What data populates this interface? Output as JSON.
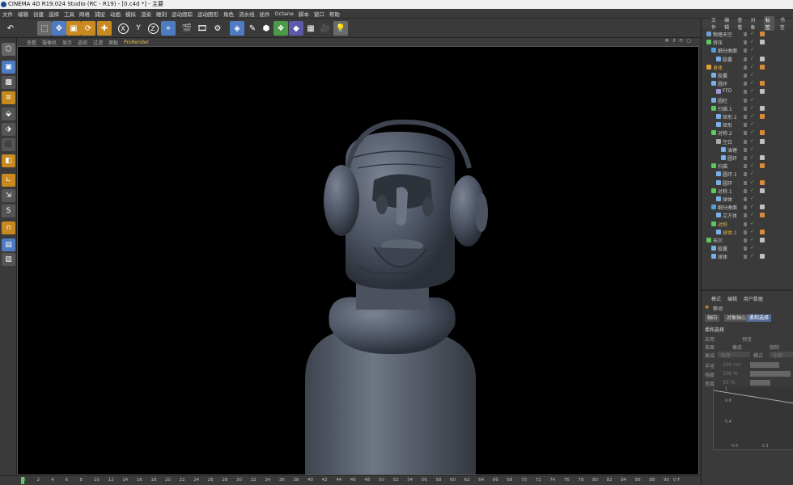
{
  "window": {
    "title": "CINEMA 4D R19.024 Studio (RC - R19) - [0.c4d *] - 主要"
  },
  "menu": [
    "文件",
    "编辑",
    "创建",
    "选择",
    "工具",
    "网格",
    "捕捉",
    "动画",
    "模拟",
    "渲染",
    "雕刻",
    "运动跟踪",
    "运动图形",
    "角色",
    "流水线",
    "插件",
    "Octane",
    "脚本",
    "窗口",
    "帮助"
  ],
  "toolbar": {
    "undo_icon": "undo-icon",
    "x_label": "X",
    "y_label": "Y",
    "z_label": "Z"
  },
  "viewport_menu": [
    "查看",
    "摄像机",
    "显示",
    "选项",
    "过滤",
    "面板"
  ],
  "viewport_menu_prorender": "ProRender",
  "viewport_nav": "✥ ⇕ ⟳ ▢",
  "timeline": {
    "ticks": [
      "0",
      "2",
      "4",
      "6",
      "8",
      "10",
      "12",
      "14",
      "16",
      "18",
      "20",
      "22",
      "24",
      "26",
      "28",
      "30",
      "32",
      "34",
      "36",
      "38",
      "40",
      "42",
      "44",
      "46",
      "48",
      "50",
      "52",
      "54",
      "56",
      "58",
      "60",
      "62",
      "64",
      "66",
      "68",
      "70",
      "72",
      "74",
      "76",
      "78",
      "80",
      "82",
      "84",
      "86",
      "88",
      "90"
    ],
    "frame_label": "0 F"
  },
  "right_tabs": [
    "文件",
    "编辑",
    "查看",
    "对象",
    "标签",
    "书签"
  ],
  "right_tabs_active": "标签",
  "objects": [
    {
      "name": "物理天空",
      "level": 0,
      "color": "#6aa0d8"
    },
    {
      "name": "挤压",
      "level": 0,
      "color": "#5ac85a"
    },
    {
      "name": "细分曲面",
      "level": 1,
      "color": "#4aa0e0"
    },
    {
      "name": "胶囊",
      "level": 2,
      "color": "#7ab0e8"
    },
    {
      "name": "身体",
      "level": 0,
      "color": "#e0a030",
      "highlight": true
    },
    {
      "name": "胶囊",
      "level": 1,
      "color": "#7ab0e8"
    },
    {
      "name": "圆环",
      "level": 1,
      "color": "#7ab0e8"
    },
    {
      "name": "FFD",
      "level": 2,
      "color": "#9a9ad8"
    },
    {
      "name": "圆柱",
      "level": 1,
      "color": "#7ab0e8"
    },
    {
      "name": "扫描.1",
      "level": 1,
      "color": "#5ac85a"
    },
    {
      "name": "矩形.1",
      "level": 2,
      "color": "#7ab0e8"
    },
    {
      "name": "矩形",
      "level": 2,
      "color": "#7ab0e8"
    },
    {
      "name": "对称.2",
      "level": 1,
      "color": "#5ac85a"
    },
    {
      "name": "空白",
      "level": 2,
      "color": "#aaaaaa"
    },
    {
      "name": "油锤",
      "level": 3,
      "color": "#7ab0e8"
    },
    {
      "name": "圆环",
      "level": 3,
      "color": "#7ab0e8"
    },
    {
      "name": "扫描",
      "level": 1,
      "color": "#5ac85a"
    },
    {
      "name": "圆环.1",
      "level": 2,
      "color": "#7ab0e8"
    },
    {
      "name": "圆环",
      "level": 2,
      "color": "#7ab0e8"
    },
    {
      "name": "对称.1",
      "level": 1,
      "color": "#5ac85a"
    },
    {
      "name": "球体",
      "level": 2,
      "color": "#7ab0e8"
    },
    {
      "name": "细分曲面",
      "level": 1,
      "color": "#4aa0e0"
    },
    {
      "name": "立方体",
      "level": 2,
      "color": "#7ab0e8"
    },
    {
      "name": "对称",
      "level": 1,
      "color": "#5ac85a",
      "highlight": true
    },
    {
      "name": "球体.1",
      "level": 2,
      "color": "#7ab0e8",
      "highlight": true
    },
    {
      "name": "布尔",
      "level": 0,
      "color": "#5ac85a"
    },
    {
      "name": "胶囊",
      "level": 1,
      "color": "#7ab0e8"
    },
    {
      "name": "球体",
      "level": 1,
      "color": "#7ab0e8"
    }
  ],
  "attributes": {
    "tabs": [
      "模式",
      "编辑",
      "用户数据"
    ],
    "tool_name": "移动",
    "subtabs": [
      "轴向",
      "对象轴心",
      "柔和选择"
    ],
    "active_subtab": "柔和选择",
    "section": "柔和选择",
    "rows": [
      "启用",
      "预览",
      "表面",
      "橡皮",
      "限制",
      "衰减",
      "线性",
      "模式",
      "全部",
      "半径",
      "100 cm",
      "强度",
      "100 %",
      "宽度",
      "50 %"
    ],
    "graph_y": [
      "1",
      "0.8",
      "0.4"
    ],
    "graph_x": [
      "0.0",
      "0.1"
    ]
  },
  "colors": {
    "accent": "#5a6e9a",
    "viewport_bg": "#000000",
    "panel_bg": "#3a3a3a"
  }
}
